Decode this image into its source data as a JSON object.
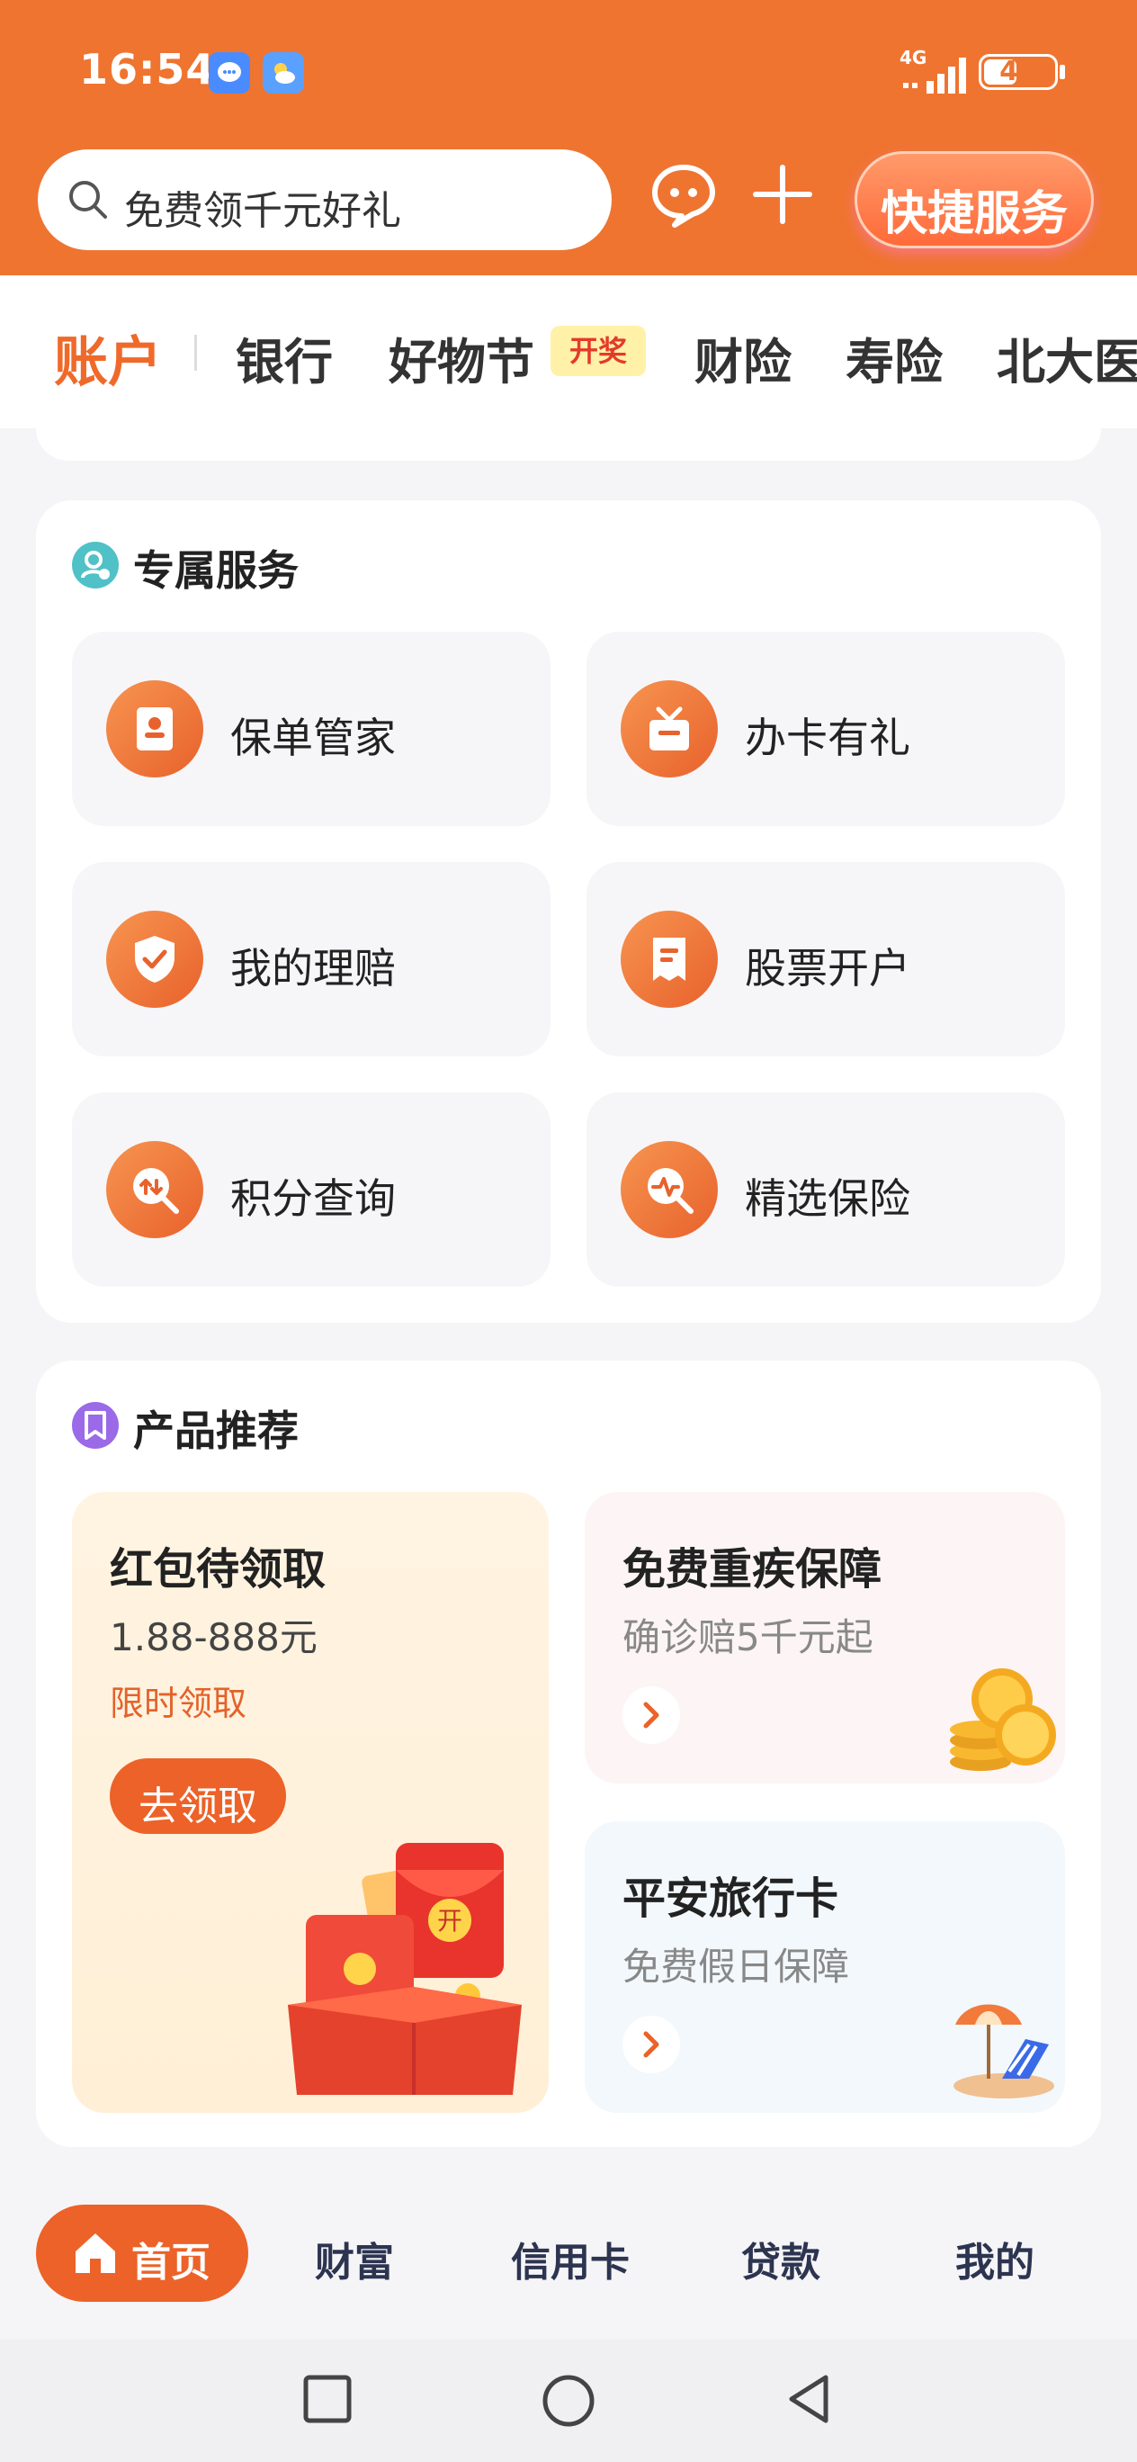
{
  "status": {
    "time": "16:54",
    "network": "4G",
    "battery": "47",
    "battery_level": 0.47
  },
  "search": {
    "placeholder": "免费领千元好礼"
  },
  "header": {
    "quick_service": "快捷服务"
  },
  "tabs": [
    {
      "label": "账户",
      "active": true
    },
    {
      "label": "银行"
    },
    {
      "label": "好物节",
      "badge": "开奖"
    },
    {
      "label": "财险"
    },
    {
      "label": "寿险"
    },
    {
      "label": "北大医"
    }
  ],
  "exclusive": {
    "title": "专属服务",
    "items": [
      {
        "label": "保单管家",
        "icon": "policy-icon"
      },
      {
        "label": "办卡有礼",
        "icon": "gift-box-icon"
      },
      {
        "label": "我的理赔",
        "icon": "shield-check-icon"
      },
      {
        "label": "股票开户",
        "icon": "receipt-icon"
      },
      {
        "label": "积分查询",
        "icon": "points-search-icon"
      },
      {
        "label": "精选保险",
        "icon": "pulse-search-icon"
      }
    ]
  },
  "products": {
    "title": "产品推荐",
    "red_packet": {
      "title": "红包待领取",
      "amount": "1.88-888元",
      "note": "限时领取",
      "button": "去领取",
      "badge": "开"
    },
    "critical": {
      "title": "免费重疾保障",
      "sub": "确诊赔5千元起"
    },
    "travel": {
      "title": "平安旅行卡",
      "sub": "免费假日保障"
    }
  },
  "nav": {
    "home": "首页",
    "wealth": "财富",
    "credit": "信用卡",
    "loan": "贷款",
    "mine": "我的"
  },
  "colors": {
    "brand": "#ef7430",
    "accent": "#ec6228"
  }
}
